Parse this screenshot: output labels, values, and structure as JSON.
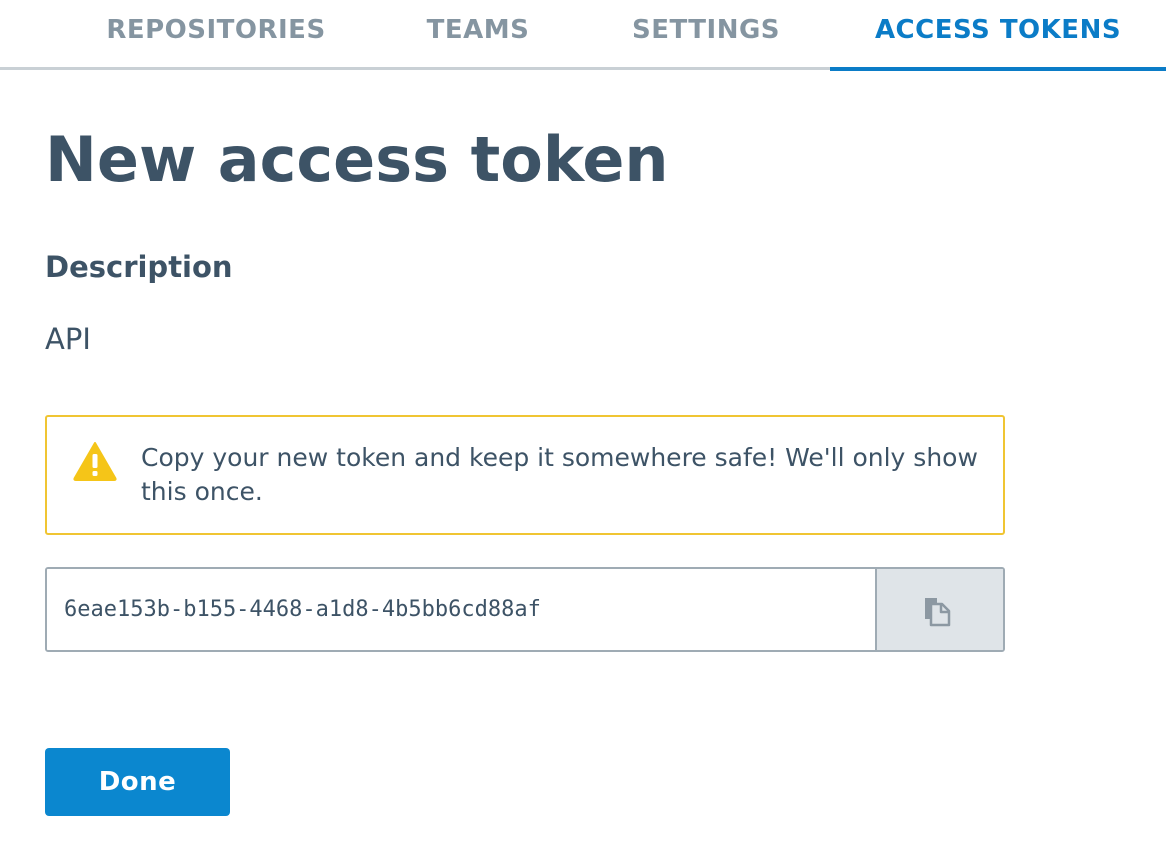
{
  "tabs": [
    {
      "label": "REPOSITORIES"
    },
    {
      "label": "TEAMS"
    },
    {
      "label": "SETTINGS"
    },
    {
      "label": "ACCESS TOKENS",
      "active": true
    }
  ],
  "page": {
    "title": "New access token"
  },
  "description": {
    "label": "Description",
    "value": "API"
  },
  "warning": {
    "icon": "warning-triangle-icon",
    "text": "Copy your new token and keep it somewhere safe! We'll only show this once."
  },
  "token": {
    "value": "6eae153b-b155-4468-a1d8-4b5bb6cd88af",
    "copy_icon": "clipboard-copy-icon"
  },
  "actions": {
    "done_label": "Done"
  },
  "colors": {
    "accent": "#0b87cf",
    "active_tab": "#0b7cc7",
    "text": "#3d5366",
    "muted_tab": "#8595a1",
    "warning_border": "#f0c533",
    "warning_icon": "#f5c518"
  }
}
